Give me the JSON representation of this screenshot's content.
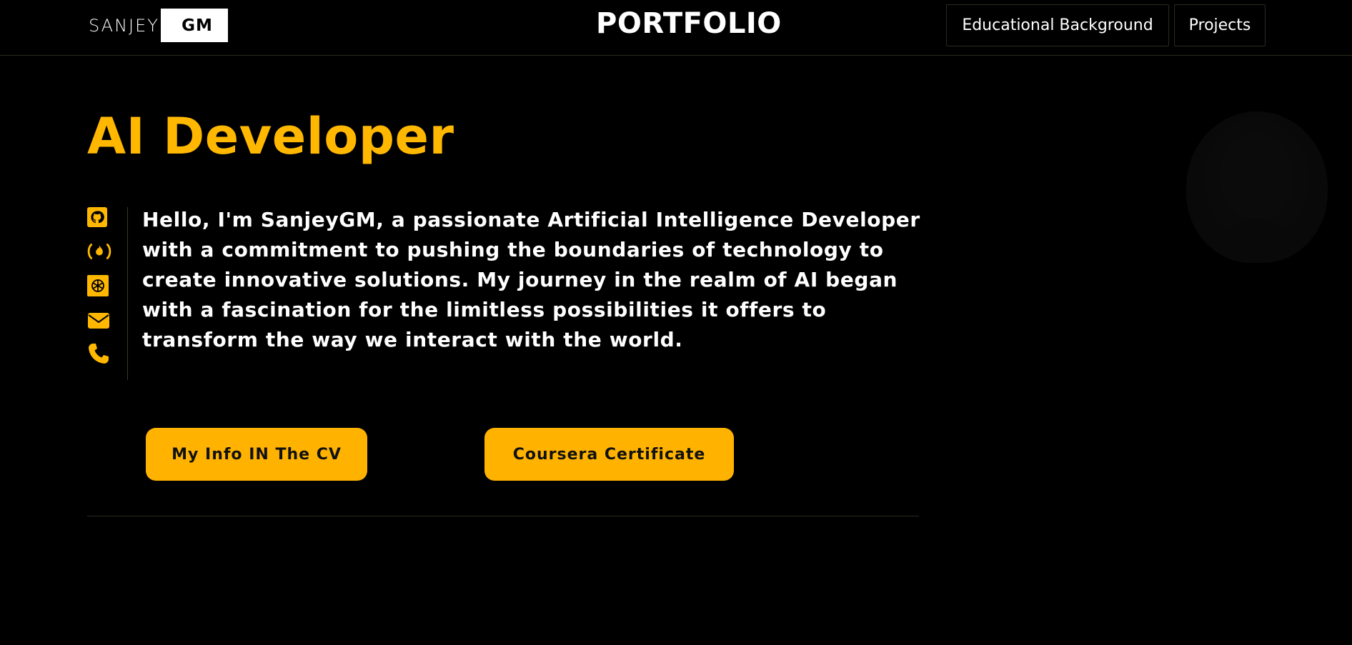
{
  "header": {
    "logo_first": "SANJEY",
    "logo_second": "GM",
    "brand_title": "PORTFOLIO",
    "nav": [
      {
        "label": "Educational Background"
      },
      {
        "label": "Projects"
      }
    ]
  },
  "hero": {
    "title": "AI Developer",
    "bio": "Hello, I'm SanjeyGM, a passionate Artificial Intelligence Developer with a commitment to pushing the boundaries of technology to create innovative solutions. My journey in the realm of AI began with a fascination for the limitless possibilities it offers to transform the way we interact with the world.",
    "social_icons": [
      "github-icon",
      "freecodecamp-icon",
      "openai-icon",
      "email-icon",
      "phone-icon"
    ],
    "buttons": {
      "cv": "My Info IN The CV",
      "certificate": "Coursera Certificate"
    }
  },
  "colors": {
    "accent": "#ffb700",
    "background": "#000000",
    "text": "#ffffff"
  }
}
